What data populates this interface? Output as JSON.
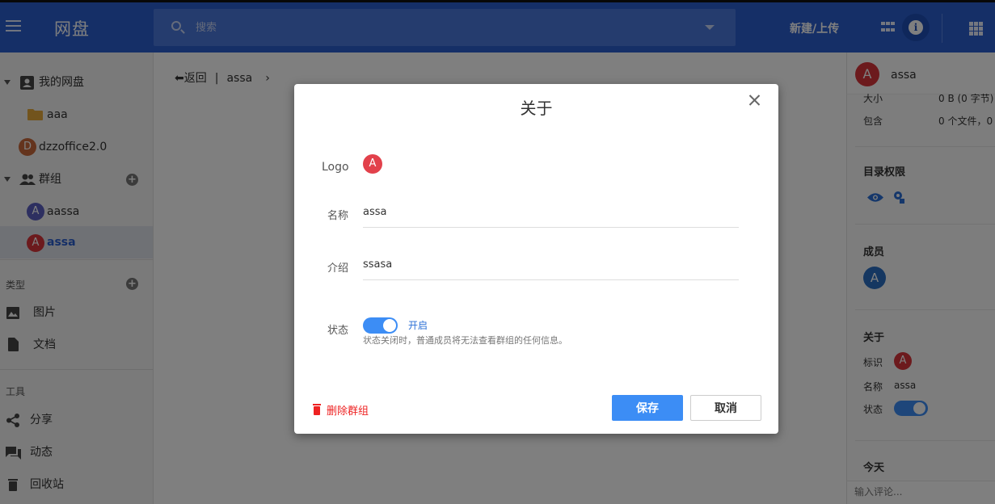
{
  "header": {
    "app_title": "网盘",
    "search_placeholder": "搜索",
    "new_upload_label": "新建/上传",
    "info_icon_glyph": "i"
  },
  "sidebar": {
    "my_drive": "我的网盘",
    "folder_aaa": "aaa",
    "dzzoffice": {
      "avatar": "D",
      "label": "dzzoffice2.0",
      "color": "#c9693a"
    },
    "groups": "群组",
    "group_items": [
      {
        "avatar": "A",
        "label": "aassa",
        "color": "#5a5fc0"
      },
      {
        "avatar": "A",
        "label": "assa",
        "color": "#d8343b",
        "active": true
      }
    ],
    "types_title": "类型",
    "images": "图片",
    "documents": "文档",
    "tools_title": "工具",
    "share": "分享",
    "activity": "动态",
    "recycle": "回收站"
  },
  "breadcrumb": {
    "back": "返回",
    "sep": "|",
    "current": "assa",
    "chevron": "›"
  },
  "right_panel": {
    "avatar": "A",
    "name": "assa",
    "size_label": "大小",
    "size_value": "0 B (0 字节)",
    "contains_label": "包含",
    "contains_value": "0 个文件，0 个",
    "permissions_title": "目录权限",
    "members_title": "成员",
    "member_avatar": "A",
    "about_title": "关于",
    "id_label": "标识",
    "id_avatar": "A",
    "name_label": "名称",
    "name_value": "assa",
    "status_label": "状态",
    "today_title": "今天",
    "comment_placeholder": "输入评论..."
  },
  "modal": {
    "title": "关于",
    "logo_label": "Logo",
    "logo_avatar": "A",
    "name_label": "名称",
    "name_value": "assa",
    "intro_label": "介绍",
    "intro_value": "ssasa",
    "status_label": "状态",
    "toggle_text": "开启",
    "status_hint": "状态关闭时，普通成员将无法查看群组的任何信息。",
    "delete_label": "删除群组",
    "save_label": "保存",
    "cancel_label": "取消"
  },
  "colors": {
    "header_blue": "#2b5fcf",
    "accent": "#3c8df5",
    "avatar_red": "#d8343b",
    "delete_red": "#e22222"
  }
}
